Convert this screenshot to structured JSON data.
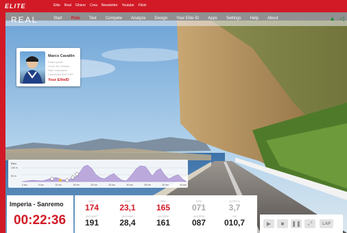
{
  "topbar": {
    "logo": "ELITE",
    "links": [
      "Elite",
      "Real",
      "Ghiere",
      "Crea",
      "Newsletter",
      "Youtube",
      "Flickr"
    ]
  },
  "nav": {
    "brand": "REAL",
    "items": [
      "Start",
      "Ride",
      "Test",
      "Compete",
      "Analyze",
      "Design",
      "Your Elite ID",
      "Apps",
      "Settings",
      "Help",
      "About"
    ],
    "active": "Ride"
  },
  "user": {
    "name": "Marco Cavallin",
    "lines": [
      "Road cyclist",
      "Level: Ex-Veteran",
      "Skill: endurance",
      "Connected ANT+/BT"
    ],
    "link": "Your EliteID"
  },
  "elevation": {
    "label": "Elev.",
    "yticks": [
      "100 m",
      "50 m"
    ],
    "xticks": [
      "0 km",
      "5 km",
      "10 km",
      "15 km",
      "20 km",
      "25 km",
      "30 km",
      "35 km",
      "40 km",
      "50 km"
    ]
  },
  "route": {
    "name": "Imperia - Sanremo",
    "time": "00:22:36"
  },
  "stats": {
    "watt": {
      "label": "WATT",
      "value": "174",
      "avg_label": "AVG WATT",
      "avg": "191"
    },
    "kmh": {
      "label": "KM/H",
      "value": "23,1",
      "avg_label": "AVG KM/H",
      "avg": "28,4"
    },
    "bpm": {
      "label": "BPM",
      "value": "165",
      "avg_label": "AVG BPM",
      "avg": "161"
    },
    "rpm": {
      "label": "RPM",
      "value": "071",
      "avg_label": "AVG RPM",
      "avg": "087"
    },
    "slope": {
      "label": "SLOPE %",
      "value": "3,7",
      "km_label": "KM",
      "km": "010,7"
    }
  },
  "controls": {
    "lap_label": "LAP"
  }
}
